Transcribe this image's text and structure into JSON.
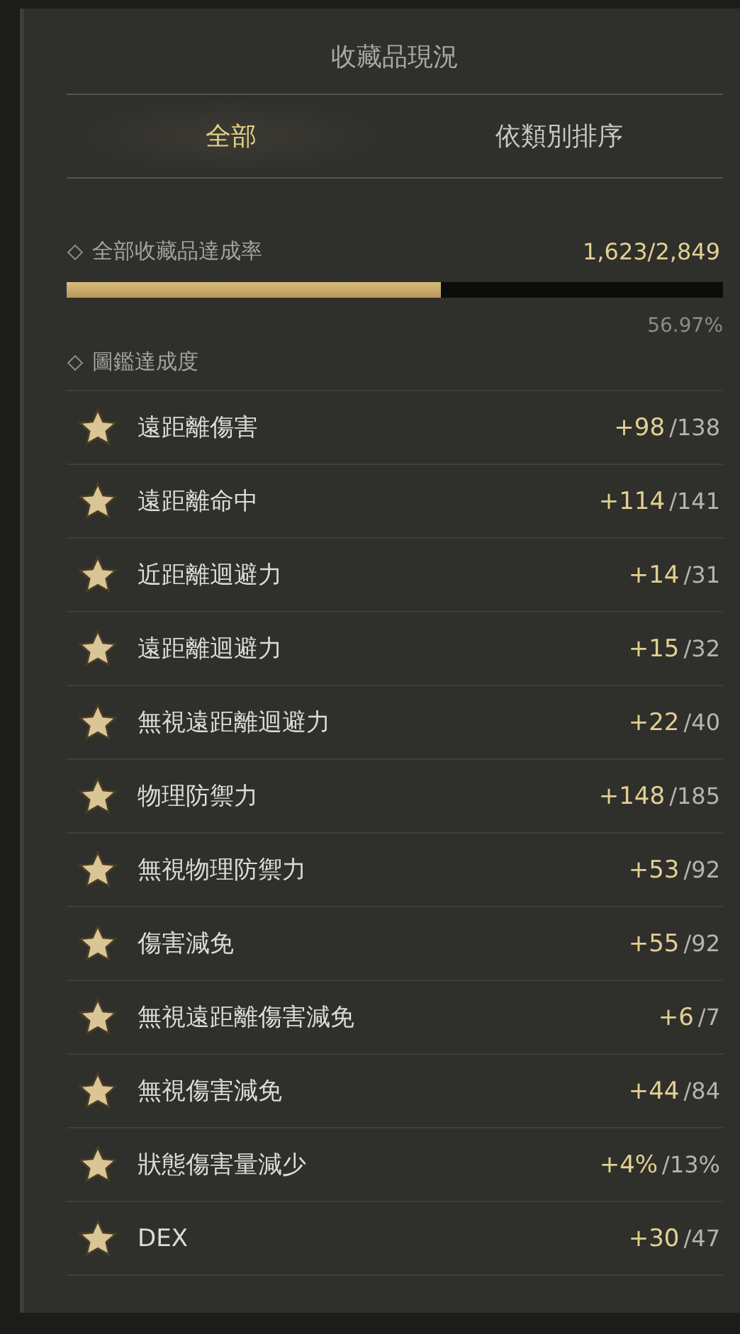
{
  "title": "收藏品現況",
  "tabs": [
    {
      "label": "全部",
      "selected": true
    },
    {
      "label": "依類別排序",
      "selected": false
    }
  ],
  "overall": {
    "label": "全部收藏品達成率",
    "count": "1,623/2,849",
    "level": 0.5697,
    "percent": "56.97%"
  },
  "codex": {
    "label": "圖鑑達成度"
  },
  "stats": [
    {
      "name": "遠距離傷害",
      "bonus": "+98",
      "max": "/138"
    },
    {
      "name": "遠距離命中",
      "bonus": "+114",
      "max": "/141"
    },
    {
      "name": "近距離迴避力",
      "bonus": "+14",
      "max": "/31"
    },
    {
      "name": "遠距離迴避力",
      "bonus": "+15",
      "max": "/32"
    },
    {
      "name": "無視遠距離迴避力",
      "bonus": "+22",
      "max": "/40"
    },
    {
      "name": "物理防禦力",
      "bonus": "+148",
      "max": "/185"
    },
    {
      "name": "無視物理防禦力",
      "bonus": "+53",
      "max": "/92"
    },
    {
      "name": "傷害減免",
      "bonus": "+55",
      "max": "/92"
    },
    {
      "name": "無視遠距離傷害減免",
      "bonus": "+6",
      "max": "/7"
    },
    {
      "name": "無視傷害減免",
      "bonus": "+44",
      "max": "/84"
    },
    {
      "name": "狀態傷害量減少",
      "bonus": "+4%",
      "max": "/13%"
    },
    {
      "name": "DEX",
      "bonus": "+30",
      "max": "/47"
    }
  ]
}
